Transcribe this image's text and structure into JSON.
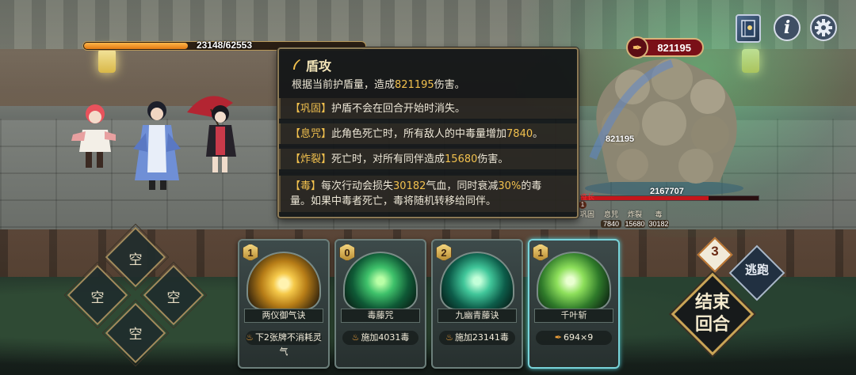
{
  "player": {
    "hp_text": "23148/62553",
    "hp_ratio": 0.37
  },
  "hud": {
    "book_icon": "book-icon",
    "info_label": "i",
    "settings_icon": "gear-icon"
  },
  "enemy": {
    "badge_value": "821195",
    "shield_value": "821195",
    "hp_value": "2167707",
    "name_tag": "疫长",
    "statuses": [
      {
        "name": "巩固",
        "value": ""
      },
      {
        "name": "息咒",
        "value": "7840"
      },
      {
        "name": "炸裂",
        "value": "15680"
      },
      {
        "name": "毒",
        "value": "30182"
      }
    ]
  },
  "tooltip": {
    "title": "盾攻",
    "desc_pre": "根据当前护盾量，造成",
    "desc_num": "821195",
    "desc_post": "伤害。",
    "rows": [
      {
        "kw": "【巩固】",
        "pre": "护盾不会在回合开始时消失。",
        "num": "",
        "post": "",
        "line2": ""
      },
      {
        "kw": "【息咒】",
        "pre": "此角色死亡时，所有敌人的中毒量增加",
        "num": "7840",
        "post": "。",
        "line2": ""
      },
      {
        "kw": "【炸裂】",
        "pre": "死亡时，对所有同伴造成",
        "num": "15680",
        "post": "伤害。",
        "line2": ""
      },
      {
        "kw": "【毒】",
        "pre": "每次行动会损失",
        "num": "30182",
        "post": "气血，同时衰减",
        "num2": "30%",
        "post2": "的毒",
        "line2": "量。如果中毒者死亡，毒将随机转移给同伴。"
      }
    ]
  },
  "slots": {
    "top": "空",
    "left": "空",
    "right": "空",
    "bottom": "空"
  },
  "cards": [
    {
      "cost": "1",
      "name": "两仪御气诀",
      "effect": "下2张牌不消耗灵气",
      "selected": false,
      "art": "gold"
    },
    {
      "cost": "0",
      "name": "毒藤咒",
      "effect": "施加4031毒",
      "selected": false,
      "art": "green"
    },
    {
      "cost": "2",
      "name": "九幽青藤诀",
      "effect": "施加23141毒",
      "selected": false,
      "art": "teal"
    },
    {
      "cost": "1",
      "name": "千叶斩",
      "effect": "694×9",
      "selected": true,
      "art": "leaf"
    }
  ],
  "controls": {
    "turn": "3",
    "flee": "逃跑",
    "end_line1": "结束",
    "end_line2": "回合"
  }
}
